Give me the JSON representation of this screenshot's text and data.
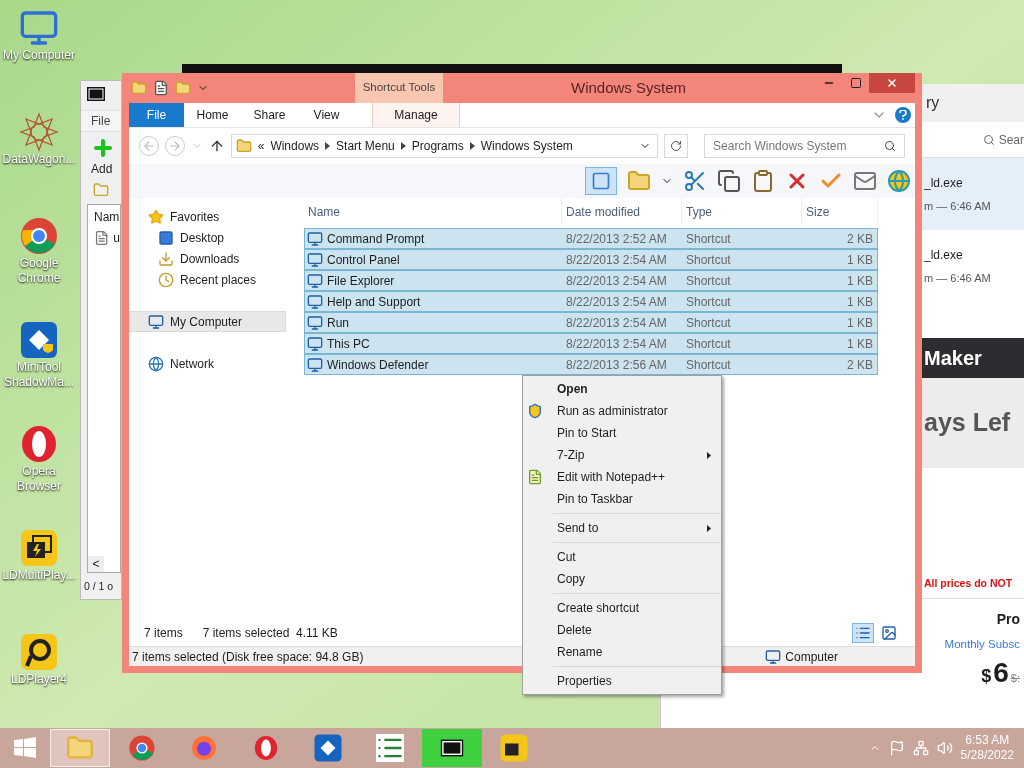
{
  "desktop_icons": [
    {
      "label": "My Computer",
      "kind": "computer"
    },
    {
      "label": "DataWagon...",
      "kind": "datawagon"
    },
    {
      "label": "Google Chrome",
      "kind": "chrome"
    },
    {
      "label": "MiniTool ShadowMa...",
      "kind": "minitool"
    },
    {
      "label": "Opera Browser",
      "kind": "opera"
    },
    {
      "label": "LDMultiPlay...",
      "kind": "ldmulti"
    },
    {
      "label": "LDPlayer4",
      "kind": "ldplayer"
    }
  ],
  "zip_window": {
    "menu": "File",
    "add": "Add",
    "column": "Nam",
    "row": "u",
    "scroll_left": "<",
    "status": "0 / 1 o"
  },
  "back_window": {
    "title": "ry",
    "search": "Sear",
    "items": [
      {
        "name": "_ld.exe",
        "time": "m — 6:46 AM",
        "selected": true
      },
      {
        "name": "_ld.exe",
        "time": "m — 6:46 AM",
        "selected": false
      }
    ],
    "banner": "Maker",
    "days": "ays Lef",
    "notice": "All prices do NOT",
    "plan": "Pro",
    "billing": "Monthly Subsc",
    "currency": "$",
    "price": "6",
    "old_price": "$:"
  },
  "explorer": {
    "title": "Windows System",
    "context_tab": "Shortcut Tools",
    "tabs": [
      {
        "label": "File",
        "kind": "file",
        "selected": false
      },
      {
        "label": "Home",
        "kind": "tab",
        "selected": false
      },
      {
        "label": "Share",
        "kind": "tab",
        "selected": false
      },
      {
        "label": "View",
        "kind": "tab",
        "selected": false
      },
      {
        "label": "Manage",
        "kind": "context",
        "selected": false
      }
    ],
    "breadcrumb_overflow": "«",
    "breadcrumb": [
      "Windows",
      "Start Menu",
      "Programs",
      "Windows System"
    ],
    "search": {
      "placeholder": "Search Windows System"
    },
    "nav": [
      {
        "label": "Favorites",
        "kind": "favorites",
        "selected": false,
        "children": [
          {
            "label": "Desktop",
            "kind": "desktop",
            "selected": false
          },
          {
            "label": "Downloads",
            "kind": "downloads",
            "selected": false
          },
          {
            "label": "Recent places",
            "kind": "recent",
            "selected": false
          }
        ]
      },
      {
        "label": "My Computer",
        "kind": "computer",
        "selected": true
      },
      {
        "label": "Network",
        "kind": "network",
        "selected": false
      }
    ],
    "columns": [
      "Name",
      "Date modified",
      "Type",
      "Size"
    ],
    "rows": [
      {
        "name": "Command Prompt",
        "date": "8/22/2013 2:52 AM",
        "type": "Shortcut",
        "size": "2 KB",
        "selected": true
      },
      {
        "name": "Control Panel",
        "date": "8/22/2013 2:54 AM",
        "type": "Shortcut",
        "size": "1 KB",
        "selected": true
      },
      {
        "name": "File Explorer",
        "date": "8/22/2013 2:54 AM",
        "type": "Shortcut",
        "size": "1 KB",
        "selected": true
      },
      {
        "name": "Help and Support",
        "date": "8/22/2013 2:54 AM",
        "type": "Shortcut",
        "size": "1 KB",
        "selected": true
      },
      {
        "name": "Run",
        "date": "8/22/2013 2:54 AM",
        "type": "Shortcut",
        "size": "1 KB",
        "selected": true
      },
      {
        "name": "This PC",
        "date": "8/22/2013 2:54 AM",
        "type": "Shortcut",
        "size": "1 KB",
        "selected": true
      },
      {
        "name": "Windows Defender",
        "date": "8/22/2013 2:56 AM",
        "type": "Shortcut",
        "size": "2 KB",
        "selected": true
      }
    ],
    "item_count": "7 items",
    "selection_info": "7 items selected  4.11 KB",
    "views": [
      {
        "kind": "details",
        "selected": true
      },
      {
        "kind": "tiles",
        "selected": false
      }
    ],
    "status": "7 items selected (Disk free space: 94.8 GB)",
    "status_location": "Computer"
  },
  "context_menu": [
    {
      "kind": "item",
      "label": "Open",
      "default": true
    },
    {
      "kind": "admin",
      "label": "Run as administrator"
    },
    {
      "kind": "item",
      "label": "Pin to Start"
    },
    {
      "kind": "submenu",
      "label": "7-Zip"
    },
    {
      "kind": "notepad",
      "label": "Edit with Notepad++"
    },
    {
      "kind": "item",
      "label": "Pin to Taskbar"
    },
    {
      "kind": "separator"
    },
    {
      "kind": "submenu",
      "label": "Send to"
    },
    {
      "kind": "separator"
    },
    {
      "kind": "item",
      "label": "Cut"
    },
    {
      "kind": "item",
      "label": "Copy"
    },
    {
      "kind": "separator"
    },
    {
      "kind": "item",
      "label": "Create shortcut"
    },
    {
      "kind": "item",
      "label": "Delete"
    },
    {
      "kind": "item",
      "label": "Rename"
    },
    {
      "kind": "separator"
    },
    {
      "kind": "item",
      "label": "Properties"
    }
  ],
  "taskbar": {
    "apps": [
      {
        "kind": "explorer",
        "selected": true
      },
      {
        "kind": "chrome",
        "selected": false
      },
      {
        "kind": "firefox",
        "selected": false
      },
      {
        "kind": "opera",
        "selected": false
      },
      {
        "kind": "minitool",
        "selected": false
      },
      {
        "kind": "notes",
        "selected": false
      },
      {
        "kind": "zip",
        "selected": false
      },
      {
        "kind": "ldmulti",
        "selected": false
      }
    ],
    "time": "6:53 AM",
    "date": "5/28/2022"
  }
}
